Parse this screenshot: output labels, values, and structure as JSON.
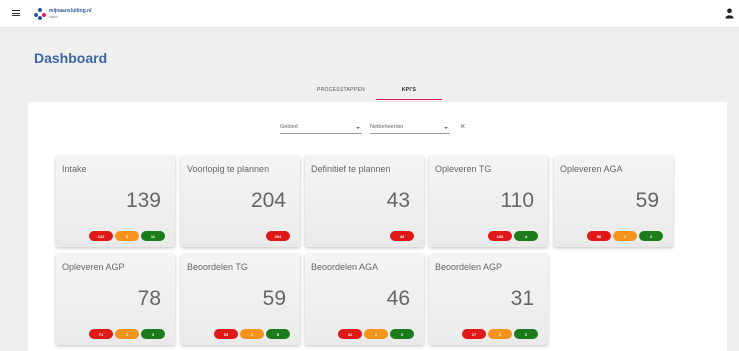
{
  "header": {
    "logo_title": "mijnaansluiting.nl",
    "logo_subtitle": "capo"
  },
  "page": {
    "title": "Dashboard"
  },
  "tabs": [
    {
      "label": "PROCESSTAPPEN",
      "active": false
    },
    {
      "label": "KPI'S",
      "active": true
    }
  ],
  "filters": {
    "gebied_label": "Gebied",
    "netbeheerder_label": "Netbeheerder"
  },
  "colors": {
    "accent": "#e91e63",
    "title": "#3a66a8",
    "red": "#e01818",
    "orange": "#f6931d",
    "green": "#1c7c1c"
  },
  "cards": [
    {
      "title": "Intake",
      "value": "139",
      "badges": [
        {
          "color": "red",
          "value": "122"
        },
        {
          "color": "orange",
          "value": "6"
        },
        {
          "color": "green",
          "value": "11"
        }
      ]
    },
    {
      "title": "Voorlopig te plannen",
      "value": "204",
      "badges": [
        {
          "color": "red",
          "value": "204"
        }
      ]
    },
    {
      "title": "Definitief te plannen",
      "value": "43",
      "badges": [
        {
          "color": "red",
          "value": "43"
        }
      ]
    },
    {
      "title": "Opleveren TG",
      "value": "110",
      "badges": [
        {
          "color": "red",
          "value": "106"
        },
        {
          "color": "green",
          "value": "4"
        }
      ]
    },
    {
      "title": "Opleveren AGA",
      "value": "59",
      "badges": [
        {
          "color": "red",
          "value": "56"
        },
        {
          "color": "orange",
          "value": "1"
        },
        {
          "color": "green",
          "value": "2"
        }
      ]
    },
    {
      "title": "Opleveren AGP",
      "value": "78",
      "badges": [
        {
          "color": "red",
          "value": "74"
        },
        {
          "color": "orange",
          "value": "1"
        },
        {
          "color": "green",
          "value": "3"
        }
      ]
    },
    {
      "title": "Beoordelen TG",
      "value": "59",
      "badges": [
        {
          "color": "red",
          "value": "53"
        },
        {
          "color": "orange",
          "value": "1"
        },
        {
          "color": "green",
          "value": "5"
        }
      ]
    },
    {
      "title": "Beoordelen AGA",
      "value": "46",
      "badges": [
        {
          "color": "red",
          "value": "41"
        },
        {
          "color": "orange",
          "value": "2"
        },
        {
          "color": "green",
          "value": "3"
        }
      ]
    },
    {
      "title": "Beoordelen AGP",
      "value": "31",
      "badges": [
        {
          "color": "red",
          "value": "27"
        },
        {
          "color": "orange",
          "value": "2"
        },
        {
          "color": "green",
          "value": "2"
        }
      ]
    }
  ]
}
